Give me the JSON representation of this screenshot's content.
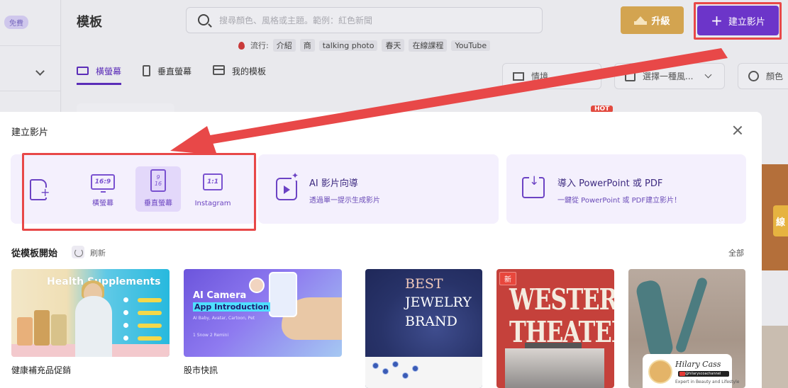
{
  "sidebar": {
    "free_badge": "免費"
  },
  "header": {
    "page_title": "模板",
    "search_placeholder": "搜尋顏色、風格或主題。範例：紅色新聞",
    "trending_label": "流行:",
    "trending_tags": [
      "介紹",
      "商",
      "talking photo",
      "春天",
      "在線課程",
      "YouTube"
    ],
    "upgrade_label": "升級",
    "create_label": "建立影片"
  },
  "tabs": [
    {
      "label": "橫螢幕",
      "active": true
    },
    {
      "label": "垂直螢幕",
      "active": false
    },
    {
      "label": "我的模板",
      "active": false
    }
  ],
  "filters": {
    "scene": "情境",
    "style": "選擇一種風...",
    "color": "顏色"
  },
  "badges": {
    "hot": "HOT",
    "side_label": "線"
  },
  "modal": {
    "title": "建立影片",
    "ratios": [
      {
        "icon_text": "16:9",
        "label": "橫螢幕"
      },
      {
        "icon_text_top": "9",
        "icon_text_bottom": "16",
        "label": "垂直螢幕"
      },
      {
        "icon_text": "1:1",
        "label": "Instagram"
      }
    ],
    "ai_card": {
      "title": "AI 影片向導",
      "subtitle": "透過單一提示生成影片"
    },
    "ppt_card": {
      "title": "導入 PowerPoint 或 PDF",
      "subtitle": "一鍵從 PowerPoint 或 PDF建立影片！"
    },
    "section_title": "從模板開始",
    "refresh_label": "刷新",
    "all_label": "全部"
  },
  "templates": [
    {
      "name": "健康補充品促銷",
      "headline": "Health Supplements"
    },
    {
      "name": "股市快訊",
      "headline_1": "AI Camera",
      "headline_2": "App Introduction",
      "meta": "AI Baby, Avatar, Cartoon, Pet",
      "bottom": "1 Snow     2 Remini"
    },
    {
      "headline_1": "BEST",
      "headline_2": "JEWELRY",
      "headline_3": "BRAND"
    },
    {
      "badge": "新",
      "headline_1": "WESTERN",
      "headline_2": "THEATER"
    },
    {
      "name_tag": "Hilary Cass",
      "handle": "@hilaryscoachannel",
      "tagline": "Expert in Beauty and Lifestyle"
    }
  ],
  "colors": {
    "accent": "#6c35c9",
    "highlight": "#e84848",
    "upgrade": "#d3a450",
    "card_bg": "#f4f0fd"
  }
}
